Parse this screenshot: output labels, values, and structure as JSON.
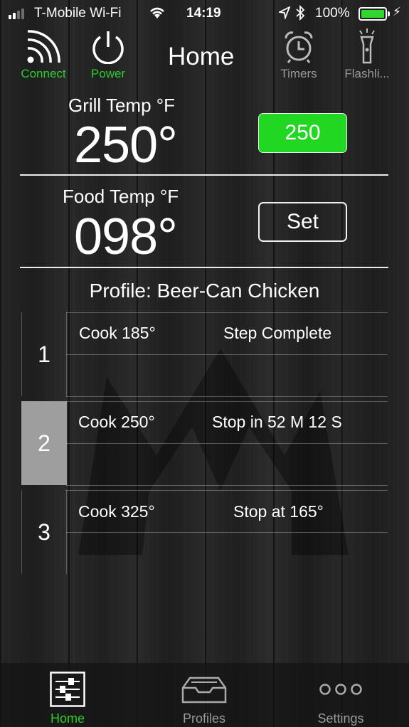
{
  "status_bar": {
    "carrier": "T-Mobile Wi-Fi",
    "time": "14:19",
    "battery_percent": "100%",
    "battery_color": "#2fd72f"
  },
  "top_nav": {
    "title": "Home",
    "connect_label": "Connect",
    "power_label": "Power",
    "timers_label": "Timers",
    "flashlight_label": "Flashli...",
    "accent_color": "#2ecc2e"
  },
  "grill": {
    "label": "Grill Temp °F",
    "value": "250°",
    "setpoint": "250",
    "setpoint_color": "#22d722"
  },
  "food": {
    "label": "Food Temp °F",
    "value": "098°",
    "set_label": "Set"
  },
  "profile": {
    "title": "Profile: Beer-Can Chicken",
    "steps": [
      {
        "number": "1",
        "cook": "Cook 185°",
        "status": "Step Complete"
      },
      {
        "number": "2",
        "cook": "Cook 250°",
        "status": "Stop in 52 M 12 S",
        "active": true
      },
      {
        "number": "3",
        "cook": "Cook 325°",
        "status": "Stop at 165°"
      }
    ]
  },
  "tab_bar": {
    "home_label": "Home",
    "profiles_label": "Profiles",
    "settings_label": "Settings"
  }
}
